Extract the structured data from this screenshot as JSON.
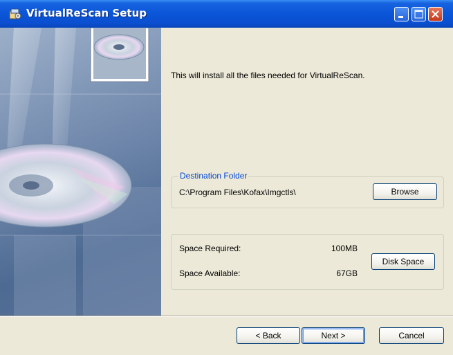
{
  "window": {
    "title": "VirtualReScan Setup"
  },
  "intro_text": "This will install all the files needed for VirtualReScan.",
  "destination": {
    "legend": "Destination Folder",
    "path": "C:\\Program Files\\Kofax\\Imgctls\\",
    "browse_label": "Browse"
  },
  "space": {
    "required_label": "Space Required:",
    "required_value": "100MB",
    "available_label": "Space Available:",
    "available_value": "67GB",
    "disk_space_label": "Disk Space"
  },
  "nav": {
    "back_label": "< Back",
    "next_label": "Next >",
    "cancel_label": "Cancel"
  },
  "icons": [
    "setup-app-icon",
    "minimize-icon",
    "maximize-icon",
    "close-icon",
    "cd-disc-icon"
  ],
  "colors": {
    "titlebar": "#0a55d8",
    "legend_text": "#0046d5",
    "dialog_bg": "#ece9d8"
  }
}
